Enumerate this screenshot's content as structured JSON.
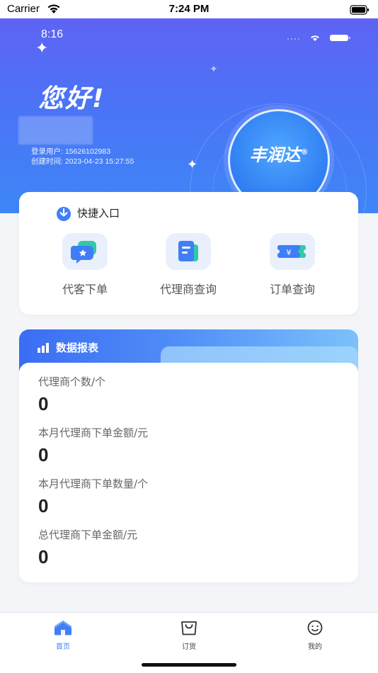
{
  "status_bar": {
    "carrier": "Carrier",
    "time": "7:24 PM"
  },
  "header": {
    "inner_time": "8:16",
    "greeting": "您好!",
    "login_user": "登录用户: 15626102983",
    "created_time": "创建时间: 2023-04-23 15:27:55",
    "logo_text": "丰润达",
    "logo_mark": "®"
  },
  "quick_entry": {
    "title": "快捷入口",
    "items": [
      {
        "label": "代客下单",
        "icon": "chat-star-icon"
      },
      {
        "label": "代理商查询",
        "icon": "document-search-icon"
      },
      {
        "label": "订单查询",
        "icon": "ticket-yen-icon"
      }
    ]
  },
  "report": {
    "title": "数据报表",
    "stats": [
      {
        "label": "代理商个数/个",
        "value": "0"
      },
      {
        "label": "本月代理商下单金额/元",
        "value": "0"
      },
      {
        "label": "本月代理商下单数量/个",
        "value": "0"
      },
      {
        "label": "总代理商下单金额/元",
        "value": "0"
      }
    ]
  },
  "tabbar": {
    "tabs": [
      {
        "label": "首页",
        "icon": "home-icon",
        "active": true
      },
      {
        "label": "订货",
        "icon": "shopping-bag-icon",
        "active": false
      },
      {
        "label": "我的",
        "icon": "smile-face-icon",
        "active": false
      }
    ]
  },
  "colors": {
    "accent": "#3f7ef6",
    "header_top": "#5e63f4",
    "header_bottom": "#3e86f7"
  }
}
